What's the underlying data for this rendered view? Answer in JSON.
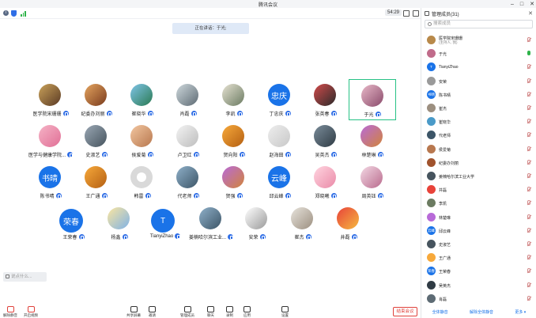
{
  "window": {
    "title": "腾讯会议"
  },
  "infobar": {
    "timer": "54:29"
  },
  "speaking": {
    "text": "正在讲话：于光;"
  },
  "grid": {
    "tiles": [
      {
        "name": "医学院宋珊珊",
        "avatar_style": "photo-a",
        "avatar_text": ""
      },
      {
        "name": "纪委办刘丽",
        "avatar_style": "photo-b",
        "avatar_text": ""
      },
      {
        "name": "崔晓华",
        "avatar_style": "photo-c",
        "avatar_text": ""
      },
      {
        "name": "肖磊",
        "avatar_style": "photo-d",
        "avatar_text": ""
      },
      {
        "name": "李凯",
        "avatar_style": "photo-e",
        "avatar_text": ""
      },
      {
        "name": "丁忠庆",
        "avatar_style": "text",
        "avatar_text": "忠庆"
      },
      {
        "name": "张英春",
        "avatar_style": "photo-f",
        "avatar_text": ""
      },
      {
        "name": "于光",
        "avatar_style": "photo-g",
        "avatar_text": "",
        "highlight": true
      },
      {
        "name": "医学与健康学院...",
        "avatar_style": "photo-h",
        "avatar_text": ""
      },
      {
        "name": "史淑艺",
        "avatar_style": "photo-i",
        "avatar_text": ""
      },
      {
        "name": "侯爱菊",
        "avatar_style": "photo-j",
        "avatar_text": ""
      },
      {
        "name": "卢卫红",
        "avatar_style": "photo-k",
        "avatar_text": ""
      },
      {
        "name": "贺向阳",
        "avatar_style": "photo-l",
        "avatar_text": ""
      },
      {
        "name": "赵海田",
        "avatar_style": "photo-m",
        "avatar_text": ""
      },
      {
        "name": "吴英杰",
        "avatar_style": "photo-n",
        "avatar_text": ""
      },
      {
        "name": "林楚琳",
        "avatar_style": "photo-o",
        "avatar_text": ""
      },
      {
        "name": "陈书晴",
        "avatar_style": "text",
        "avatar_text": "书晴"
      },
      {
        "name": "王广通",
        "avatar_style": "photo-l",
        "avatar_text": ""
      },
      {
        "name": "韩雷",
        "avatar_style": "gray",
        "avatar_text": ""
      },
      {
        "name": "代老师",
        "avatar_style": "photo-s",
        "avatar_text": ""
      },
      {
        "name": "贺强",
        "avatar_style": "photo-o",
        "avatar_text": ""
      },
      {
        "name": "邱云峰",
        "avatar_style": "text",
        "avatar_text": "云峰"
      },
      {
        "name": "郑晓曦",
        "avatar_style": "photo-p",
        "avatar_text": ""
      },
      {
        "name": "周英钰",
        "avatar_style": "photo-q",
        "avatar_text": ""
      },
      {
        "name": "王荣春",
        "avatar_style": "text",
        "avatar_text": "荣春"
      },
      {
        "name": "杨鑫",
        "avatar_style": "photo-r",
        "avatar_text": ""
      },
      {
        "name": "TianyiZhao",
        "avatar_style": "text",
        "avatar_text": "T"
      },
      {
        "name": "姜楠哈尔滨工业...",
        "avatar_style": "photo-s",
        "avatar_text": ""
      },
      {
        "name": "安荣",
        "avatar_style": "photo-t",
        "avatar_text": ""
      },
      {
        "name": "崔杰",
        "avatar_style": "photo-u",
        "avatar_text": ""
      },
      {
        "name": "井磊",
        "avatar_style": "photo-v",
        "avatar_text": ""
      }
    ]
  },
  "chatbox": {
    "placeholder": "说点什么..."
  },
  "toolbar": {
    "items": [
      {
        "label": "解除静音",
        "icon": "microphone-off-icon",
        "red": true
      },
      {
        "label": "开启视频",
        "icon": "video-off-icon",
        "red": true
      },
      {
        "label": "共享屏幕",
        "icon": "share-screen-icon"
      },
      {
        "label": "邀请",
        "icon": "invite-icon"
      },
      {
        "label": "管理成员",
        "icon": "members-icon"
      },
      {
        "label": "聊天",
        "icon": "chat-icon"
      },
      {
        "label": "录制",
        "icon": "record-icon"
      },
      {
        "label": "应用",
        "icon": "apps-icon"
      },
      {
        "label": "设置",
        "icon": "settings-icon"
      }
    ],
    "end_label": "结束会议"
  },
  "panel": {
    "title": "管理成员(31)",
    "search_placeholder": "搜索成员",
    "members": [
      {
        "name": "医学院宋珊珊",
        "sub": "(主持人, 我)",
        "mic_on": false,
        "color": "#b8894a",
        "avatar_text": ""
      },
      {
        "name": "于光",
        "sub": "",
        "mic_on": true,
        "color": "#c06b8a",
        "avatar_text": ""
      },
      {
        "name": "TianyiZhao",
        "sub": "",
        "mic_on": false,
        "color": "#1a73e8",
        "avatar_text": "T"
      },
      {
        "name": "安荣",
        "sub": "",
        "mic_on": false,
        "color": "#9a9a9a",
        "avatar_text": ""
      },
      {
        "name": "陈书晴",
        "sub": "",
        "mic_on": false,
        "color": "#1a73e8",
        "avatar_text": "书晴"
      },
      {
        "name": "崔杰",
        "sub": "",
        "mic_on": false,
        "color": "#9c8f80",
        "avatar_text": ""
      },
      {
        "name": "崔晓华",
        "sub": "",
        "mic_on": false,
        "color": "#4a9ac8",
        "avatar_text": ""
      },
      {
        "name": "代老师",
        "sub": "",
        "mic_on": false,
        "color": "#3c5567",
        "avatar_text": ""
      },
      {
        "name": "侯爱菊",
        "sub": "",
        "mic_on": false,
        "color": "#b8784f",
        "avatar_text": ""
      },
      {
        "name": "纪委办刘丽",
        "sub": "",
        "mic_on": false,
        "color": "#a0522d",
        "avatar_text": ""
      },
      {
        "name": "姜楠哈尔滨工业大学",
        "sub": "",
        "mic_on": false,
        "color": "#46545e",
        "avatar_text": ""
      },
      {
        "name": "井磊",
        "sub": "",
        "mic_on": false,
        "color": "#e8433a",
        "avatar_text": ""
      },
      {
        "name": "李凯",
        "sub": "",
        "mic_on": false,
        "color": "#6b7b61",
        "avatar_text": ""
      },
      {
        "name": "林楚琳",
        "sub": "",
        "mic_on": false,
        "color": "#b86ad8",
        "avatar_text": ""
      },
      {
        "name": "邱云峰",
        "sub": "",
        "mic_on": false,
        "color": "#1a73e8",
        "avatar_text": "云峰"
      },
      {
        "name": "史淑艺",
        "sub": "",
        "mic_on": false,
        "color": "#46545e",
        "avatar_text": ""
      },
      {
        "name": "王广通",
        "sub": "",
        "mic_on": false,
        "color": "#f7a93b",
        "avatar_text": ""
      },
      {
        "name": "王荣春",
        "sub": "",
        "mic_on": false,
        "color": "#1a73e8",
        "avatar_text": "荣春"
      },
      {
        "name": "吴英杰",
        "sub": "",
        "mic_on": false,
        "color": "#2f3b44",
        "avatar_text": ""
      },
      {
        "name": "肖磊",
        "sub": "",
        "mic_on": false,
        "color": "#5d6b74",
        "avatar_text": ""
      }
    ],
    "footer": {
      "mute_all": "全体静音",
      "unmute_all": "解除全体静音",
      "more": "更多 ▾"
    }
  },
  "colors": {
    "accent": "#1a73e8",
    "highlight": "#27c285",
    "danger": "#e0413b"
  }
}
